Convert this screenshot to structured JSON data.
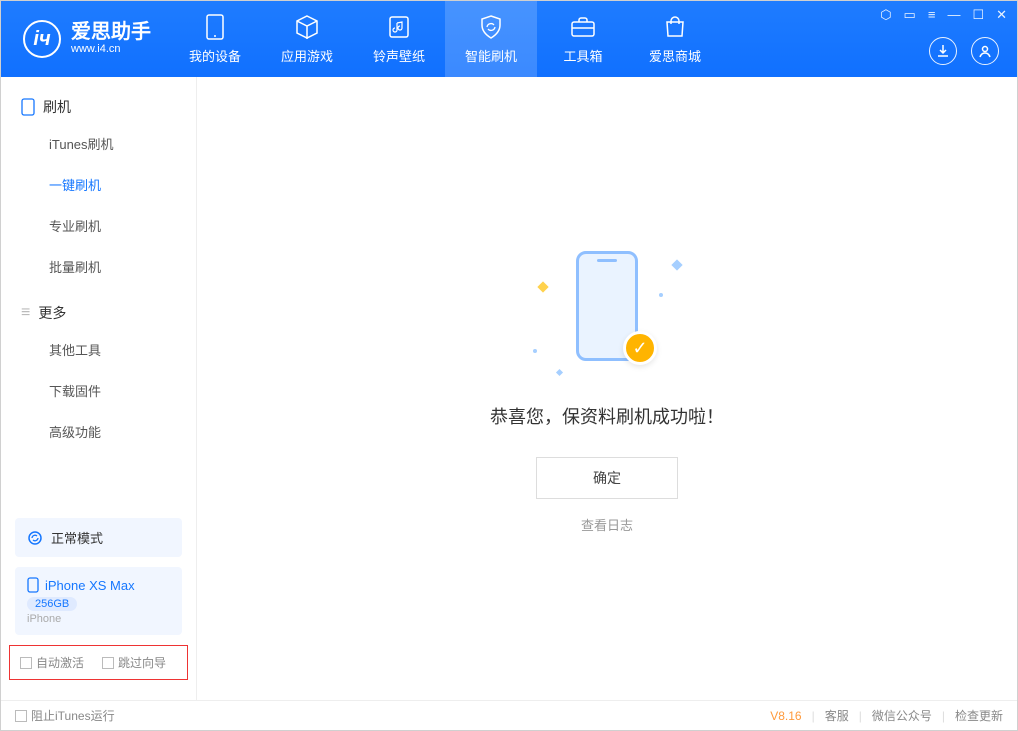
{
  "app": {
    "name_cn": "爱思助手",
    "name_en": "www.i4.cn"
  },
  "tabs": [
    {
      "label": "我的设备"
    },
    {
      "label": "应用游戏"
    },
    {
      "label": "铃声壁纸"
    },
    {
      "label": "智能刷机"
    },
    {
      "label": "工具箱"
    },
    {
      "label": "爱思商城"
    }
  ],
  "sidebar": {
    "group1": "刷机",
    "items1": [
      {
        "label": "iTunes刷机"
      },
      {
        "label": "一键刷机"
      },
      {
        "label": "专业刷机"
      },
      {
        "label": "批量刷机"
      }
    ],
    "group2": "更多",
    "items2": [
      {
        "label": "其他工具"
      },
      {
        "label": "下载固件"
      },
      {
        "label": "高级功能"
      }
    ]
  },
  "mode": {
    "label": "正常模式"
  },
  "device": {
    "name": "iPhone XS Max",
    "capacity": "256GB",
    "sub": "iPhone"
  },
  "options": {
    "auto_activate": "自动激活",
    "skip_guide": "跳过向导"
  },
  "main": {
    "success": "恭喜您，保资料刷机成功啦！",
    "ok": "确定",
    "log": "查看日志"
  },
  "footer": {
    "block_itunes": "阻止iTunes运行",
    "version": "V8.16",
    "service": "客服",
    "wechat": "微信公众号",
    "update": "检查更新"
  }
}
